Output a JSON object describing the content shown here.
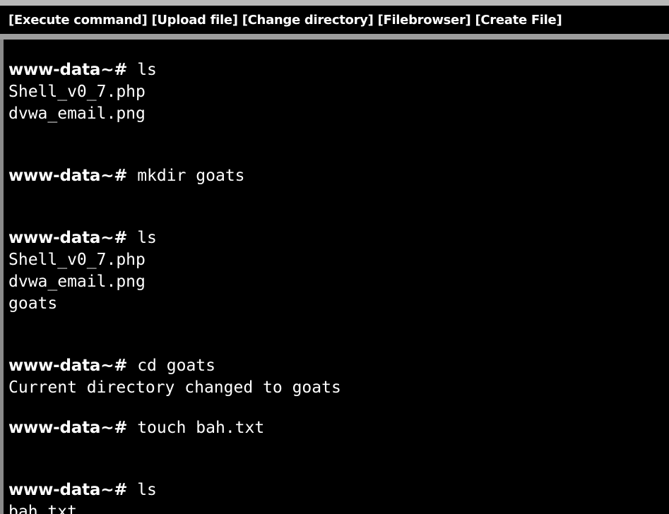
{
  "menu": [
    {
      "label": "[Execute command]"
    },
    {
      "label": "[Upload file]"
    },
    {
      "label": "[Change directory]"
    },
    {
      "label": "[Filebrowser]"
    },
    {
      "label": "[Create File]"
    }
  ],
  "console": {
    "prompt": "www-data~#",
    "entries": [
      {
        "command": "ls",
        "output": [
          "Shell_v0_7.php",
          "dvwa_email.png"
        ]
      },
      {
        "command": "mkdir goats",
        "output": []
      },
      {
        "command": "ls",
        "output": [
          "Shell_v0_7.php",
          "dvwa_email.png",
          "goats"
        ]
      },
      {
        "command": "cd goats",
        "output": [
          "Current directory changed to goats"
        ]
      },
      {
        "command": "touch bah.txt",
        "output": []
      },
      {
        "command": "ls",
        "output": [
          "bah.txt"
        ]
      }
    ]
  },
  "colors": {
    "background": "#000000",
    "text": "#ffffff",
    "toolbar_border": "#b8b8b8"
  }
}
